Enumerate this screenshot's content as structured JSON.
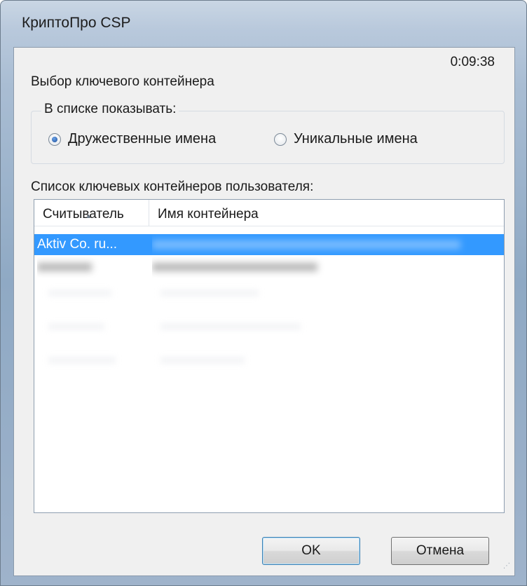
{
  "window": {
    "title": "КриптоПро CSP"
  },
  "dialog": {
    "timer": "0:09:38",
    "prompt": "Выбор ключевого контейнера",
    "display_group": {
      "legend": "В списке показывать:",
      "options": [
        {
          "label": "Дружественные имена",
          "checked": true
        },
        {
          "label": "Уникальные имена",
          "checked": false
        }
      ]
    },
    "list_label": "Список ключевых контейнеров пользователя:",
    "table": {
      "columns": [
        "Считыватель",
        "Имя контейнера"
      ],
      "rows": [
        {
          "reader": "Aktiv Co. ru...",
          "container": "",
          "selected": true
        },
        {
          "reader": "",
          "container": "",
          "selected": false
        }
      ]
    },
    "buttons": {
      "ok": "OK",
      "cancel": "Отмена"
    }
  },
  "colors": {
    "selection": "#3399ff",
    "frame": "#a9bdd3"
  }
}
